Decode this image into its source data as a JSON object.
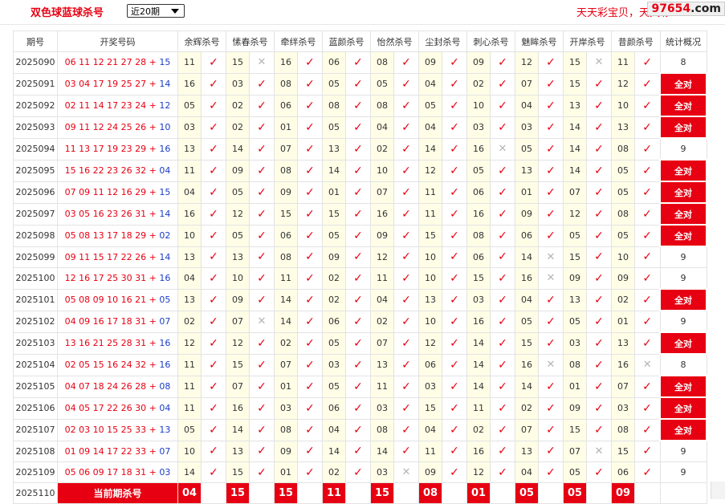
{
  "header": {
    "title": "双色球蓝球杀号",
    "period_select": "近20期",
    "marquee": "天天彩宝贝，天天彩",
    "watermark_prefix": "97654",
    "watermark_suffix": ".com"
  },
  "table": {
    "columns": [
      "期号",
      "开奖号码",
      "余辉杀号",
      "愫春杀号",
      "牵绊杀号",
      "蓝颜杀号",
      "怡然杀号",
      "尘封杀号",
      "刺心杀号",
      "魅眸杀号",
      "开岸杀号",
      "昔颜杀号",
      "统计概况"
    ],
    "rows": [
      {
        "issue": "2025090",
        "red": "06 11 12 21 27 28",
        "blue": "15",
        "kills": [
          [
            "11",
            true
          ],
          [
            "15",
            false
          ],
          [
            "16",
            true
          ],
          [
            "06",
            true
          ],
          [
            "08",
            true
          ],
          [
            "09",
            true
          ],
          [
            "09",
            true
          ],
          [
            "12",
            true
          ],
          [
            "15",
            false
          ],
          [
            "11",
            true
          ]
        ],
        "stat": "8"
      },
      {
        "issue": "2025091",
        "red": "03 04 17 19 25 27",
        "blue": "14",
        "kills": [
          [
            "16",
            true
          ],
          [
            "03",
            true
          ],
          [
            "08",
            true
          ],
          [
            "05",
            true
          ],
          [
            "05",
            true
          ],
          [
            "04",
            true
          ],
          [
            "02",
            true
          ],
          [
            "07",
            true
          ],
          [
            "15",
            true
          ],
          [
            "12",
            true
          ]
        ],
        "stat": "全对"
      },
      {
        "issue": "2025092",
        "red": "02 11 14 17 23 24",
        "blue": "12",
        "kills": [
          [
            "05",
            true
          ],
          [
            "02",
            true
          ],
          [
            "06",
            true
          ],
          [
            "08",
            true
          ],
          [
            "08",
            true
          ],
          [
            "05",
            true
          ],
          [
            "10",
            true
          ],
          [
            "04",
            true
          ],
          [
            "13",
            true
          ],
          [
            "10",
            true
          ]
        ],
        "stat": "全对"
      },
      {
        "issue": "2025093",
        "red": "09 11 12 24 25 26",
        "blue": "10",
        "kills": [
          [
            "03",
            true
          ],
          [
            "02",
            true
          ],
          [
            "01",
            true
          ],
          [
            "05",
            true
          ],
          [
            "04",
            true
          ],
          [
            "04",
            true
          ],
          [
            "03",
            true
          ],
          [
            "03",
            true
          ],
          [
            "14",
            true
          ],
          [
            "13",
            true
          ]
        ],
        "stat": "全对"
      },
      {
        "issue": "2025094",
        "red": "11 13 17 19 23 29",
        "blue": "16",
        "kills": [
          [
            "13",
            true
          ],
          [
            "14",
            true
          ],
          [
            "07",
            true
          ],
          [
            "13",
            true
          ],
          [
            "02",
            true
          ],
          [
            "14",
            true
          ],
          [
            "16",
            false
          ],
          [
            "05",
            true
          ],
          [
            "14",
            true
          ],
          [
            "08",
            true
          ]
        ],
        "stat": "9"
      },
      {
        "issue": "2025095",
        "red": "15 16 22 23 26 32",
        "blue": "04",
        "kills": [
          [
            "11",
            true
          ],
          [
            "09",
            true
          ],
          [
            "08",
            true
          ],
          [
            "14",
            true
          ],
          [
            "10",
            true
          ],
          [
            "12",
            true
          ],
          [
            "05",
            true
          ],
          [
            "13",
            true
          ],
          [
            "14",
            true
          ],
          [
            "05",
            true
          ]
        ],
        "stat": "全对"
      },
      {
        "issue": "2025096",
        "red": "07 09 11 12 16 29",
        "blue": "15",
        "kills": [
          [
            "04",
            true
          ],
          [
            "05",
            true
          ],
          [
            "09",
            true
          ],
          [
            "01",
            true
          ],
          [
            "07",
            true
          ],
          [
            "11",
            true
          ],
          [
            "06",
            true
          ],
          [
            "01",
            true
          ],
          [
            "07",
            true
          ],
          [
            "05",
            true
          ]
        ],
        "stat": "全对"
      },
      {
        "issue": "2025097",
        "red": "03 05 16 23 26 31",
        "blue": "14",
        "kills": [
          [
            "16",
            true
          ],
          [
            "12",
            true
          ],
          [
            "15",
            true
          ],
          [
            "15",
            true
          ],
          [
            "16",
            true
          ],
          [
            "11",
            true
          ],
          [
            "16",
            true
          ],
          [
            "09",
            true
          ],
          [
            "12",
            true
          ],
          [
            "08",
            true
          ]
        ],
        "stat": "全对"
      },
      {
        "issue": "2025098",
        "red": "05 08 13 17 18 29",
        "blue": "02",
        "kills": [
          [
            "10",
            true
          ],
          [
            "05",
            true
          ],
          [
            "06",
            true
          ],
          [
            "05",
            true
          ],
          [
            "09",
            true
          ],
          [
            "15",
            true
          ],
          [
            "08",
            true
          ],
          [
            "06",
            true
          ],
          [
            "05",
            true
          ],
          [
            "05",
            true
          ]
        ],
        "stat": "全对"
      },
      {
        "issue": "2025099",
        "red": "09 11 15 17 22 26",
        "blue": "14",
        "kills": [
          [
            "13",
            true
          ],
          [
            "13",
            true
          ],
          [
            "08",
            true
          ],
          [
            "09",
            true
          ],
          [
            "12",
            true
          ],
          [
            "10",
            true
          ],
          [
            "06",
            true
          ],
          [
            "14",
            false
          ],
          [
            "15",
            true
          ],
          [
            "10",
            true
          ]
        ],
        "stat": "9"
      },
      {
        "issue": "2025100",
        "red": "12 16 17 25 30 31",
        "blue": "16",
        "kills": [
          [
            "04",
            true
          ],
          [
            "10",
            true
          ],
          [
            "11",
            true
          ],
          [
            "02",
            true
          ],
          [
            "11",
            true
          ],
          [
            "10",
            true
          ],
          [
            "15",
            true
          ],
          [
            "16",
            false
          ],
          [
            "09",
            true
          ],
          [
            "09",
            true
          ]
        ],
        "stat": "9"
      },
      {
        "issue": "2025101",
        "red": "05 08 09 10 16 21",
        "blue": "05",
        "kills": [
          [
            "13",
            true
          ],
          [
            "09",
            true
          ],
          [
            "14",
            true
          ],
          [
            "02",
            true
          ],
          [
            "04",
            true
          ],
          [
            "13",
            true
          ],
          [
            "03",
            true
          ],
          [
            "04",
            true
          ],
          [
            "13",
            true
          ],
          [
            "02",
            true
          ]
        ],
        "stat": "全对"
      },
      {
        "issue": "2025102",
        "red": "04 09 16 17 18 31",
        "blue": "07",
        "kills": [
          [
            "02",
            true
          ],
          [
            "07",
            false
          ],
          [
            "14",
            true
          ],
          [
            "06",
            true
          ],
          [
            "02",
            true
          ],
          [
            "10",
            true
          ],
          [
            "16",
            true
          ],
          [
            "05",
            true
          ],
          [
            "05",
            true
          ],
          [
            "01",
            true
          ]
        ],
        "stat": "9"
      },
      {
        "issue": "2025103",
        "red": "13 16 21 25 28 31",
        "blue": "16",
        "kills": [
          [
            "12",
            true
          ],
          [
            "12",
            true
          ],
          [
            "02",
            true
          ],
          [
            "05",
            true
          ],
          [
            "07",
            true
          ],
          [
            "12",
            true
          ],
          [
            "14",
            true
          ],
          [
            "15",
            true
          ],
          [
            "03",
            true
          ],
          [
            "13",
            true
          ]
        ],
        "stat": "全对"
      },
      {
        "issue": "2025104",
        "red": "02 05 15 16 24 32",
        "blue": "16",
        "kills": [
          [
            "11",
            true
          ],
          [
            "15",
            true
          ],
          [
            "07",
            true
          ],
          [
            "03",
            true
          ],
          [
            "13",
            true
          ],
          [
            "06",
            true
          ],
          [
            "14",
            true
          ],
          [
            "16",
            false
          ],
          [
            "08",
            true
          ],
          [
            "16",
            false
          ]
        ],
        "stat": "8"
      },
      {
        "issue": "2025105",
        "red": "04 07 18 24 26 28",
        "blue": "08",
        "kills": [
          [
            "11",
            true
          ],
          [
            "07",
            true
          ],
          [
            "01",
            true
          ],
          [
            "05",
            true
          ],
          [
            "11",
            true
          ],
          [
            "03",
            true
          ],
          [
            "14",
            true
          ],
          [
            "14",
            true
          ],
          [
            "01",
            true
          ],
          [
            "07",
            true
          ]
        ],
        "stat": "全对"
      },
      {
        "issue": "2025106",
        "red": "04 05 17 22 26 30",
        "blue": "04",
        "kills": [
          [
            "11",
            true
          ],
          [
            "16",
            true
          ],
          [
            "03",
            true
          ],
          [
            "06",
            true
          ],
          [
            "03",
            true
          ],
          [
            "15",
            true
          ],
          [
            "11",
            true
          ],
          [
            "02",
            true
          ],
          [
            "09",
            true
          ],
          [
            "03",
            true
          ]
        ],
        "stat": "全对"
      },
      {
        "issue": "2025107",
        "red": "02 03 10 15 25 33",
        "blue": "13",
        "kills": [
          [
            "05",
            true
          ],
          [
            "14",
            true
          ],
          [
            "08",
            true
          ],
          [
            "04",
            true
          ],
          [
            "08",
            true
          ],
          [
            "04",
            true
          ],
          [
            "02",
            true
          ],
          [
            "07",
            true
          ],
          [
            "15",
            true
          ],
          [
            "08",
            true
          ]
        ],
        "stat": "全对"
      },
      {
        "issue": "2025108",
        "red": "01 09 14 17 22 33",
        "blue": "07",
        "kills": [
          [
            "10",
            true
          ],
          [
            "13",
            true
          ],
          [
            "09",
            true
          ],
          [
            "14",
            true
          ],
          [
            "14",
            true
          ],
          [
            "11",
            true
          ],
          [
            "16",
            true
          ],
          [
            "13",
            true
          ],
          [
            "07",
            false
          ],
          [
            "15",
            true
          ]
        ],
        "stat": "9"
      },
      {
        "issue": "2025109",
        "red": "05 06 09 17 18 31",
        "blue": "03",
        "kills": [
          [
            "14",
            true
          ],
          [
            "15",
            true
          ],
          [
            "01",
            true
          ],
          [
            "02",
            true
          ],
          [
            "03",
            false
          ],
          [
            "09",
            true
          ],
          [
            "12",
            true
          ],
          [
            "04",
            true
          ],
          [
            "05",
            true
          ],
          [
            "06",
            true
          ]
        ],
        "stat": "9"
      }
    ],
    "current": {
      "issue": "2025110",
      "label": "当前期杀号",
      "kills": [
        "04",
        "15",
        "15",
        "11",
        "15",
        "08",
        "01",
        "05",
        "05",
        "09"
      ]
    }
  },
  "icons": {
    "correct": "check-icon",
    "wrong": "cross-icon"
  },
  "colors": {
    "accent": "#e60012",
    "blue_ball": "#1a3cc8",
    "highlight": "#fffde6"
  }
}
